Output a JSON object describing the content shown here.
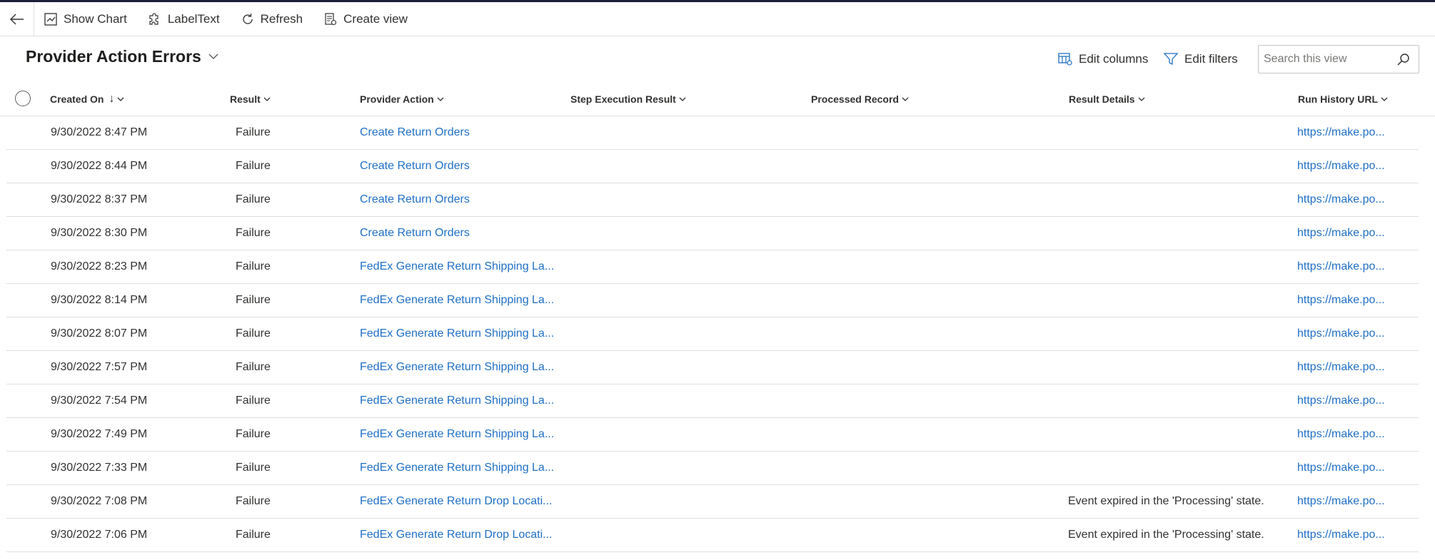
{
  "commandbar": {
    "show_chart": "Show Chart",
    "label_text": "LabelText",
    "refresh": "Refresh",
    "create_view": "Create view"
  },
  "view": {
    "title": "Provider Action Errors",
    "edit_columns": "Edit columns",
    "edit_filters": "Edit filters",
    "search_placeholder": "Search this view"
  },
  "grid": {
    "columns": {
      "created_on": "Created On",
      "result": "Result",
      "provider_action": "Provider Action",
      "step_execution_result": "Step Execution Result",
      "processed_record": "Processed Record",
      "result_details": "Result Details",
      "run_history_url": "Run History URL"
    },
    "sort_indicator": "↓",
    "rows": [
      {
        "created_on": "9/30/2022 8:47 PM",
        "result": "Failure",
        "provider_action": "Create Return Orders",
        "result_details": "",
        "run_history_url": "https://make.po..."
      },
      {
        "created_on": "9/30/2022 8:44 PM",
        "result": "Failure",
        "provider_action": "Create Return Orders",
        "result_details": "",
        "run_history_url": "https://make.po..."
      },
      {
        "created_on": "9/30/2022 8:37 PM",
        "result": "Failure",
        "provider_action": "Create Return Orders",
        "result_details": "",
        "run_history_url": "https://make.po..."
      },
      {
        "created_on": "9/30/2022 8:30 PM",
        "result": "Failure",
        "provider_action": "Create Return Orders",
        "result_details": "",
        "run_history_url": "https://make.po..."
      },
      {
        "created_on": "9/30/2022 8:23 PM",
        "result": "Failure",
        "provider_action": "FedEx Generate Return Shipping La...",
        "result_details": "",
        "run_history_url": "https://make.po..."
      },
      {
        "created_on": "9/30/2022 8:14 PM",
        "result": "Failure",
        "provider_action": "FedEx Generate Return Shipping La...",
        "result_details": "",
        "run_history_url": "https://make.po..."
      },
      {
        "created_on": "9/30/2022 8:07 PM",
        "result": "Failure",
        "provider_action": "FedEx Generate Return Shipping La...",
        "result_details": "",
        "run_history_url": "https://make.po..."
      },
      {
        "created_on": "9/30/2022 7:57 PM",
        "result": "Failure",
        "provider_action": "FedEx Generate Return Shipping La...",
        "result_details": "",
        "run_history_url": "https://make.po..."
      },
      {
        "created_on": "9/30/2022 7:54 PM",
        "result": "Failure",
        "provider_action": "FedEx Generate Return Shipping La...",
        "result_details": "",
        "run_history_url": "https://make.po..."
      },
      {
        "created_on": "9/30/2022 7:49 PM",
        "result": "Failure",
        "provider_action": "FedEx Generate Return Shipping La...",
        "result_details": "",
        "run_history_url": "https://make.po..."
      },
      {
        "created_on": "9/30/2022 7:33 PM",
        "result": "Failure",
        "provider_action": "FedEx Generate Return Shipping La...",
        "result_details": "",
        "run_history_url": "https://make.po..."
      },
      {
        "created_on": "9/30/2022 7:08 PM",
        "result": "Failure",
        "provider_action": "FedEx Generate Return Drop Locati...",
        "result_details": "Event expired in the 'Processing' state.",
        "run_history_url": "https://make.po..."
      },
      {
        "created_on": "9/30/2022 7:06 PM",
        "result": "Failure",
        "provider_action": "FedEx Generate Return Drop Locati...",
        "result_details": "Event expired in the 'Processing' state.",
        "run_history_url": "https://make.po..."
      }
    ]
  },
  "colors": {
    "link": "#1f6fc5",
    "text": "#323130",
    "border": "#e1dfdd",
    "topline": "#1b1f3b"
  }
}
